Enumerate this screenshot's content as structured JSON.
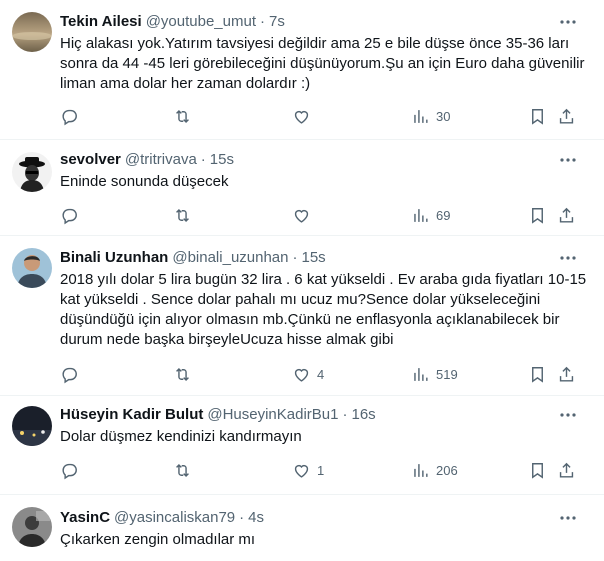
{
  "tweets": [
    {
      "name": "Tekin Ailesi",
      "handle": "@youtube_umut",
      "sep": "·",
      "time": "7s",
      "text": "Hiç alakası yok.Yatırım tavsiyesi değildir ama 25 e bile düşse önce 35-36 ları sonra da 44 -45 leri görebileceğini düşünüyorum.Şu an için Euro daha güvenilir liman ama dolar her zaman dolardır :)",
      "replies": "",
      "retweets": "",
      "likes": "",
      "views": "30"
    },
    {
      "name": "sevolver",
      "handle": "@tritrivava",
      "sep": "·",
      "time": "15s",
      "text": "Eninde sonunda düşecek",
      "replies": "",
      "retweets": "",
      "likes": "",
      "views": "69"
    },
    {
      "name": "Binali Uzunhan",
      "handle": "@binali_uzunhan",
      "sep": "·",
      "time": "15s",
      "text": "2018 yılı dolar 5 lira bugün 32 lira . 6 kat yükseldi . Ev araba gıda fiyatları 10-15 kat yükseldi . Sence dolar pahalı mı ucuz mu?Sence dolar yükseleceğini düşündüğü için alıyor olmasın mb.Çünkü ne enflasyonla açıklanabilecek bir durum nede başka birşeyleUcuza hisse almak gibi",
      "replies": "",
      "retweets": "",
      "likes": "4",
      "views": "519"
    },
    {
      "name": "Hüseyin Kadir Bulut",
      "handle": "@HuseyinKadirBu1",
      "sep": "·",
      "time": "16s",
      "text": "Dolar düşmez kendinizi kandırmayın",
      "replies": "",
      "retweets": "",
      "likes": "1",
      "views": "206"
    },
    {
      "name": "YasinC",
      "handle": "@yasincaliskan79",
      "sep": "·",
      "time": "4s",
      "text": "Çıkarken zengin olmadılar mı",
      "replies": "",
      "retweets": "",
      "likes": "",
      "views": ""
    }
  ],
  "icons": {
    "more": "more-horizontal-icon",
    "reply": "reply-icon",
    "retweet": "retweet-icon",
    "like": "heart-icon",
    "views": "views-chart-icon",
    "bookmark": "bookmark-icon",
    "share": "share-icon"
  },
  "colors": {
    "text": "#0f1419",
    "muted": "#536471",
    "divider": "#eff3f4"
  }
}
